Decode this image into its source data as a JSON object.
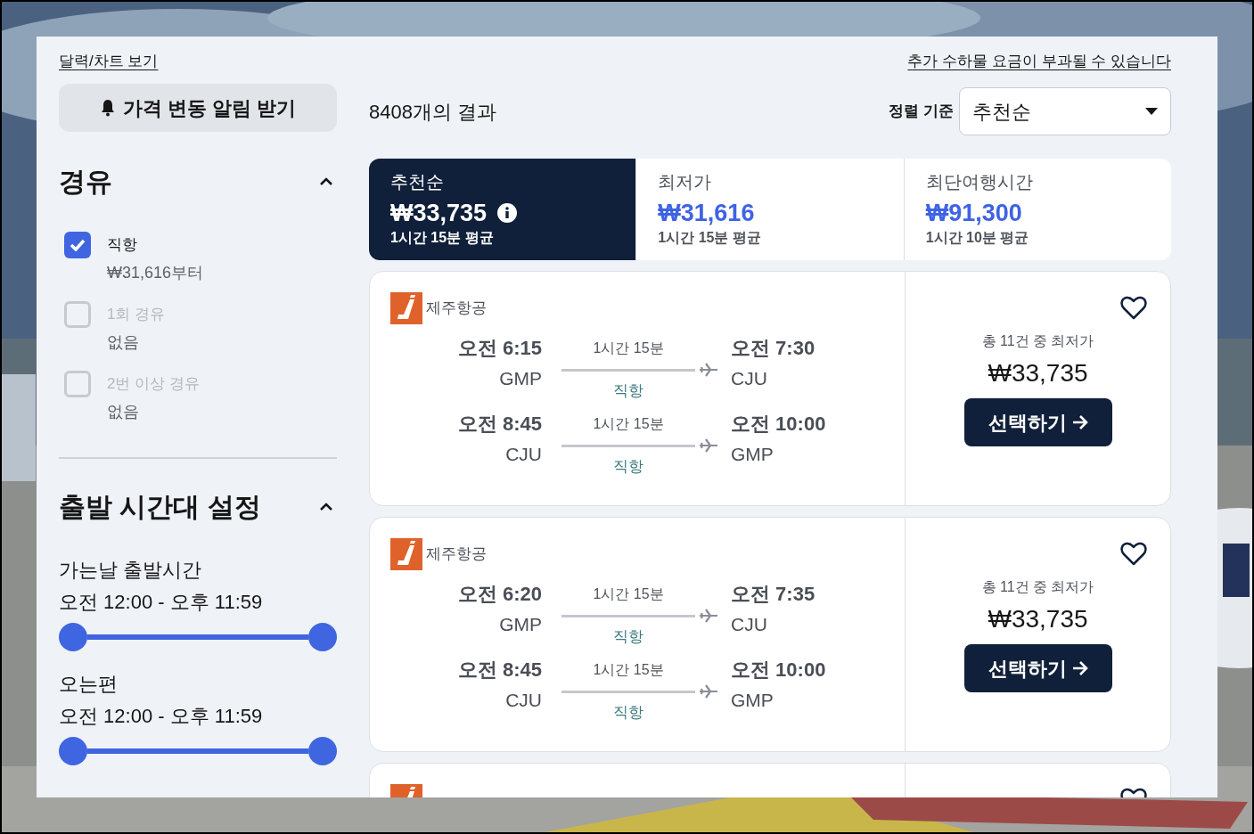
{
  "calendar_link": "달력/차트 보기",
  "baggage_notice": "추가 수하물 요금이 부과될 수 있습니다",
  "price_alert_button": "가격 변동 알림 받기",
  "stops_filter": {
    "title": "경유",
    "expanded": true,
    "options": [
      {
        "label": "직항",
        "sublabel": "₩31,616부터",
        "checked": true,
        "disabled": false
      },
      {
        "label": "1회 경유",
        "sublabel": "없음",
        "checked": false,
        "disabled": true
      },
      {
        "label": "2번 이상 경유",
        "sublabel": "없음",
        "checked": false,
        "disabled": true
      }
    ]
  },
  "time_filter": {
    "title": "출발 시간대 설정",
    "expanded": true,
    "ranges": [
      {
        "label": "가는날 출발시간",
        "value": "오전 12:00 - 오후 11:59",
        "level": 1
      },
      {
        "label": "오는편",
        "value": "오전 12:00 - 오후 11:59",
        "level": 1
      }
    ]
  },
  "results_count": "8408개의 결과",
  "sort": {
    "label": "정렬 기준",
    "value": "추천순"
  },
  "sort_tabs": [
    {
      "title": "추천순",
      "price": "₩33,735",
      "duration": "1시간 15분 평균",
      "selected": true,
      "info": true
    },
    {
      "title": "최저가",
      "price": "₩31,616",
      "duration": "1시간 15분 평균",
      "selected": false,
      "info": false
    },
    {
      "title": "최단여행시간",
      "price": "₩91,300",
      "duration": "1시간 10분 평균",
      "selected": false,
      "info": false
    }
  ],
  "results": [
    {
      "airline": "제주항공",
      "favorited": false,
      "price_caption": "총 11건 중 최저가",
      "price": "₩33,735",
      "select_button": "선택하기",
      "legs": [
        {
          "depart_time": "오전 6:15",
          "depart_airport": "GMP",
          "duration": "1시간 15분",
          "stops": "직항",
          "arrive_time": "오전 7:30",
          "arrive_airport": "CJU"
        },
        {
          "depart_time": "오전 8:45",
          "depart_airport": "CJU",
          "duration": "1시간 15분",
          "stops": "직항",
          "arrive_time": "오전 10:00",
          "arrive_airport": "GMP"
        }
      ]
    },
    {
      "airline": "제주항공",
      "favorited": false,
      "price_caption": "총 11건 중 최저가",
      "price": "₩33,735",
      "select_button": "선택하기",
      "legs": [
        {
          "depart_time": "오전 6:20",
          "depart_airport": "GMP",
          "duration": "1시간 15분",
          "stops": "직항",
          "arrive_time": "오전 7:35",
          "arrive_airport": "CJU"
        },
        {
          "depart_time": "오전 8:45",
          "depart_airport": "CJU",
          "duration": "1시간 15분",
          "stops": "직항",
          "arrive_time": "오전 10:00",
          "arrive_airport": "GMP"
        }
      ]
    },
    {
      "favorited": false
    }
  ]
}
